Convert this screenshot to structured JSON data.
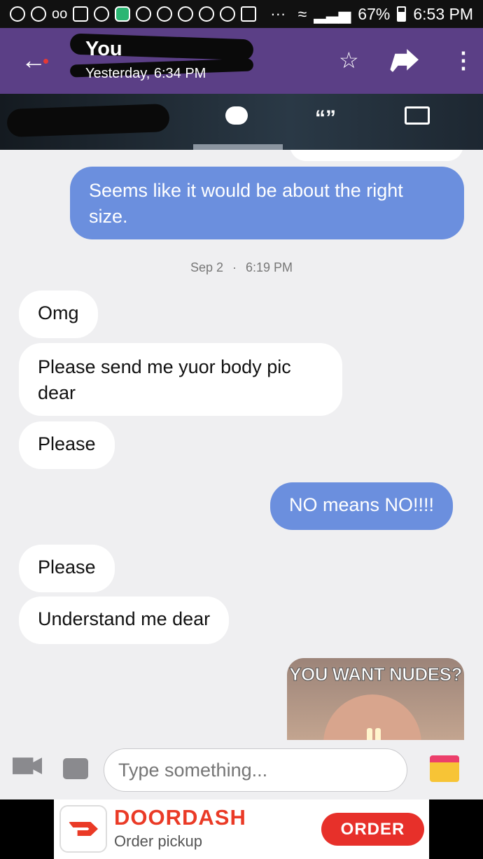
{
  "status_bar": {
    "battery": "67%",
    "time": "6:53 PM"
  },
  "header": {
    "title": "You",
    "subtitle": "Yesterday, 6:34 PM"
  },
  "tabs": [
    {
      "icon": "chat-bubble-icon"
    },
    {
      "icon": "quote-icon"
    },
    {
      "icon": "photos-icon"
    }
  ],
  "messages": [
    {
      "side": "out",
      "text": "Seems like it would be about the right size."
    },
    {
      "side": "in",
      "text": "Omg"
    },
    {
      "side": "in",
      "text": "Please send me yuor body pic dear"
    },
    {
      "side": "in",
      "text": "Please"
    },
    {
      "side": "out",
      "text": "NO means NO!!!!"
    },
    {
      "side": "in",
      "text": "Please"
    },
    {
      "side": "in",
      "text": "Understand me dear"
    }
  ],
  "timestamp": {
    "date": "Sep 2",
    "sep": "·",
    "time": "6:19 PM"
  },
  "image_message": {
    "caption": "YOU WANT NUDES?"
  },
  "input": {
    "placeholder": "Type something..."
  },
  "ad": {
    "title": "DOORDASH",
    "subtitle": "Order pickup",
    "button": "ORDER"
  },
  "colors": {
    "header": "#5b3f86",
    "outgoing": "#6b8fde",
    "incoming": "#ffffff",
    "ad_red": "#ea3a26"
  }
}
